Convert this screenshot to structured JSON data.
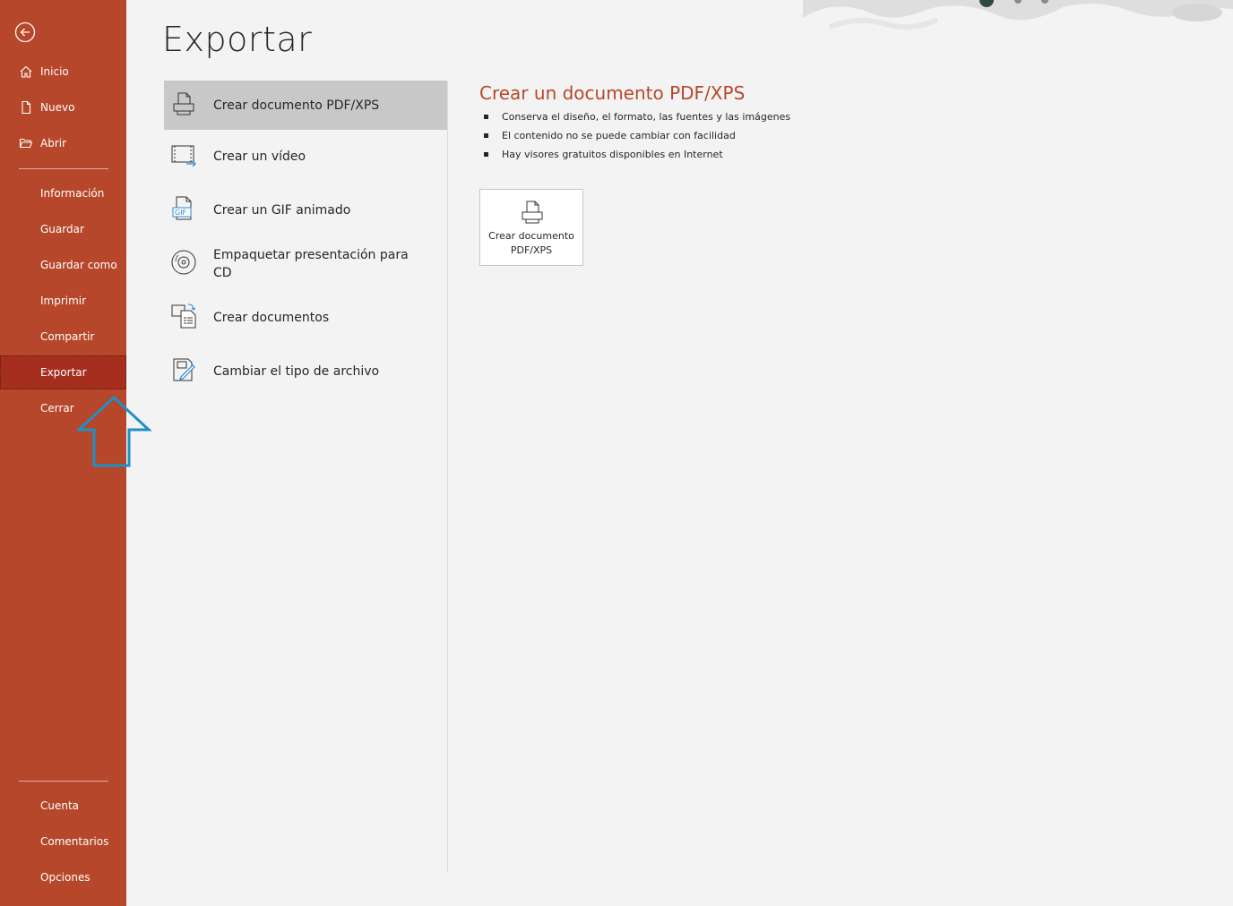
{
  "sidebar": {
    "top_items": [
      {
        "label": "Inicio",
        "icon": "home-icon"
      },
      {
        "label": "Nuevo",
        "icon": "new-document-icon"
      },
      {
        "label": "Abrir",
        "icon": "folder-open-icon"
      }
    ],
    "mid_items": [
      {
        "label": "Información"
      },
      {
        "label": "Guardar"
      },
      {
        "label": "Guardar como"
      },
      {
        "label": "Imprimir"
      },
      {
        "label": "Compartir"
      },
      {
        "label": "Exportar",
        "active": true
      },
      {
        "label": "Cerrar"
      }
    ],
    "bottom_items": [
      {
        "label": "Cuenta"
      },
      {
        "label": "Comentarios"
      },
      {
        "label": "Opciones"
      }
    ]
  },
  "page": {
    "title": "Exportar"
  },
  "export_options": [
    {
      "label": "Crear documento PDF/XPS",
      "icon": "pdf-document-icon",
      "selected": true
    },
    {
      "label": "Crear un vídeo",
      "icon": "video-icon"
    },
    {
      "label": "Crear un GIF animado",
      "icon": "gif-icon"
    },
    {
      "label": "Empaquetar presentación para CD",
      "icon": "cd-icon"
    },
    {
      "label": "Crear documentos",
      "icon": "handouts-icon"
    },
    {
      "label": "Cambiar el tipo de archivo",
      "icon": "change-file-type-icon"
    }
  ],
  "detail": {
    "title": "Crear un documento PDF/XPS",
    "bullets": [
      "Conserva el diseño, el formato, las fuentes y las imágenes",
      "El contenido no se puede cambiar con facilidad",
      "Hay visores gratuitos disponibles en Internet"
    ],
    "action_button": {
      "line1": "Crear documento",
      "line2": "PDF/XPS"
    }
  },
  "colors": {
    "sidebar_bg": "#b7472a",
    "sidebar_active": "#a52e1f",
    "accent_title": "#b7472a",
    "selected_item": "#c8c8c8",
    "annotation_arrow": "#1e90c8"
  }
}
